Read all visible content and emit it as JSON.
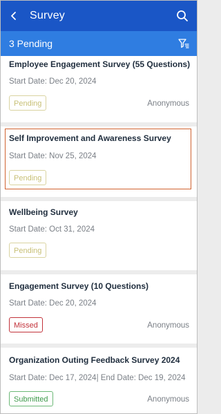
{
  "header": {
    "title": "Survey",
    "back_icon": "chevron-left-icon",
    "search_icon": "search-icon"
  },
  "subheader": {
    "count_label": "3 Pending",
    "filter_icon": "filter-icon"
  },
  "colors": {
    "appbar": "#1a56c6",
    "subbar": "#2f7de1",
    "pending": "#c8c077",
    "missed": "#c2323a",
    "submitted": "#3f9a4c",
    "highlight": "#d0622f"
  },
  "surveys": [
    {
      "title": "Employee Engagement Survey (55 Questions)",
      "dates": "Start Date: Dec 20, 2024",
      "status": "Pending",
      "anonymous": "Anonymous"
    },
    {
      "title": "Self Improvement and Awareness Survey",
      "dates": "Start Date: Nov 25, 2024",
      "status": "Pending",
      "highlighted": true
    },
    {
      "title": "Wellbeing Survey",
      "dates": "Start Date: Oct 31, 2024",
      "status": "Pending"
    },
    {
      "title": "Engagement Survey (10 Questions)",
      "dates": "Start Date: Dec 20, 2024",
      "status": "Missed",
      "anonymous": "Anonymous"
    },
    {
      "title": "Organization Outing Feedback Survey 2024",
      "dates": "Start Date: Dec 17, 2024| End Date: Dec 19, 2024",
      "status": "Submitted",
      "anonymous": "Anonymous"
    }
  ]
}
